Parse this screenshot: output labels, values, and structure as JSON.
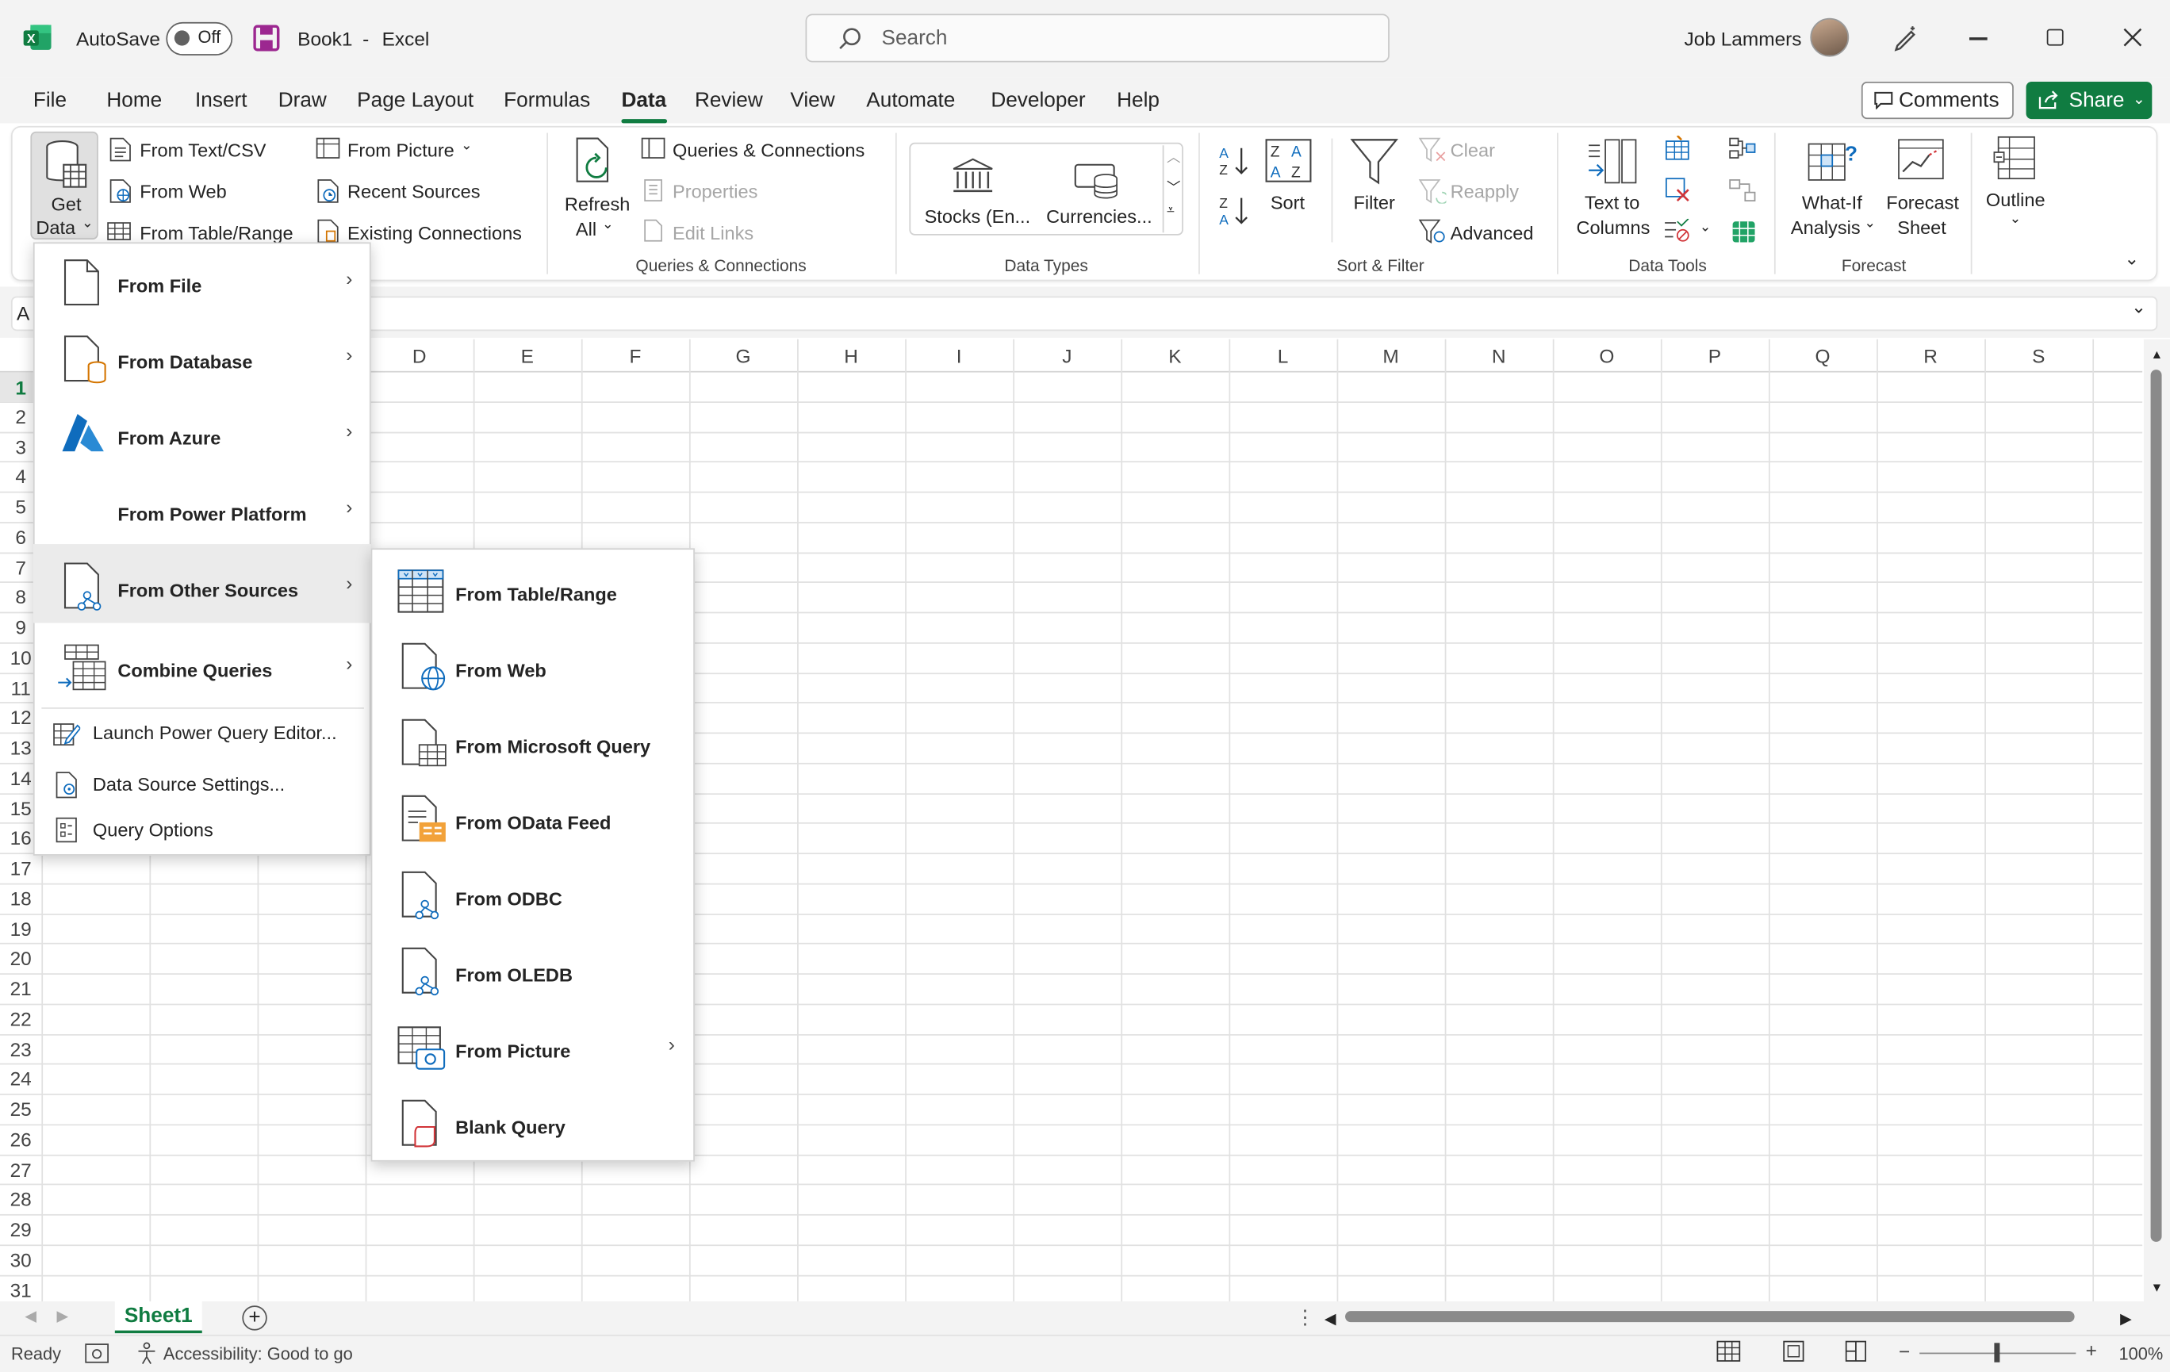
{
  "app": {
    "autosave_label": "AutoSave",
    "autosave_state": "Off",
    "doc_title": "Book1",
    "app_name": "Excel",
    "separator": "-",
    "search_placeholder": "Search",
    "user_name": "Job Lammers"
  },
  "tabs": [
    "File",
    "Home",
    "Insert",
    "Draw",
    "Page Layout",
    "Formulas",
    "Data",
    "Review",
    "View",
    "Automate",
    "Developer",
    "Help"
  ],
  "active_tab": "Data",
  "actions": {
    "comments": "Comments",
    "share": "Share"
  },
  "ribbon": {
    "get_data": {
      "line1": "Get",
      "line2": "Data"
    },
    "get_transform": [
      "From Text/CSV",
      "From Web",
      "From Table/Range",
      "From Picture",
      "Recent Sources",
      "Existing Connections"
    ],
    "refresh": {
      "line1": "Refresh",
      "line2": "All"
    },
    "queries": {
      "items": [
        "Queries & Connections",
        "Properties",
        "Edit Links"
      ],
      "group": "Queries & Connections"
    },
    "data_types": {
      "items": [
        "Stocks (En...",
        "Currencies..."
      ],
      "group": "Data Types"
    },
    "sort_filter": {
      "sort": "Sort",
      "filter": "Filter",
      "clear": "Clear",
      "reapply": "Reapply",
      "advanced": "Advanced",
      "group": "Sort & Filter"
    },
    "data_tools": {
      "line1": "Text to",
      "line2": "Columns",
      "group": "Data Tools"
    },
    "forecast": {
      "whatif1": "What-If",
      "whatif2": "Analysis",
      "sheet1": "Forecast",
      "sheet2": "Sheet",
      "group": "Forecast"
    },
    "outline": "Outline"
  },
  "formula": {
    "name_box": "A"
  },
  "columns": [
    "D",
    "E",
    "F",
    "G",
    "H",
    "I",
    "J",
    "K",
    "L",
    "M",
    "N",
    "O",
    "P",
    "Q",
    "R",
    "S"
  ],
  "rows": [
    "1",
    "2",
    "3",
    "4",
    "5",
    "6",
    "7",
    "8",
    "9",
    "10",
    "11",
    "12",
    "13",
    "14",
    "15",
    "16",
    "17",
    "18",
    "19",
    "20",
    "21",
    "22",
    "23",
    "24",
    "25",
    "26",
    "27",
    "28",
    "29",
    "30",
    "31"
  ],
  "get_data_menu": {
    "items": [
      "From File",
      "From Database",
      "From Azure",
      "From Power Platform",
      "From Other Sources",
      "Combine Queries"
    ],
    "commands": [
      "Launch Power Query Editor...",
      "Data Source Settings...",
      "Query Options"
    ]
  },
  "other_sources_menu": {
    "items": [
      "From Table/Range",
      "From Web",
      "From Microsoft Query",
      "From OData Feed",
      "From ODBC",
      "From OLEDB",
      "From Picture",
      "Blank Query"
    ]
  },
  "sheet": {
    "name": "Sheet1"
  },
  "status": {
    "ready": "Ready",
    "accessibility": "Accessibility: Good to go",
    "zoom": "100%"
  },
  "colors": {
    "accent": "#107c41",
    "excel_green": "#217346"
  }
}
